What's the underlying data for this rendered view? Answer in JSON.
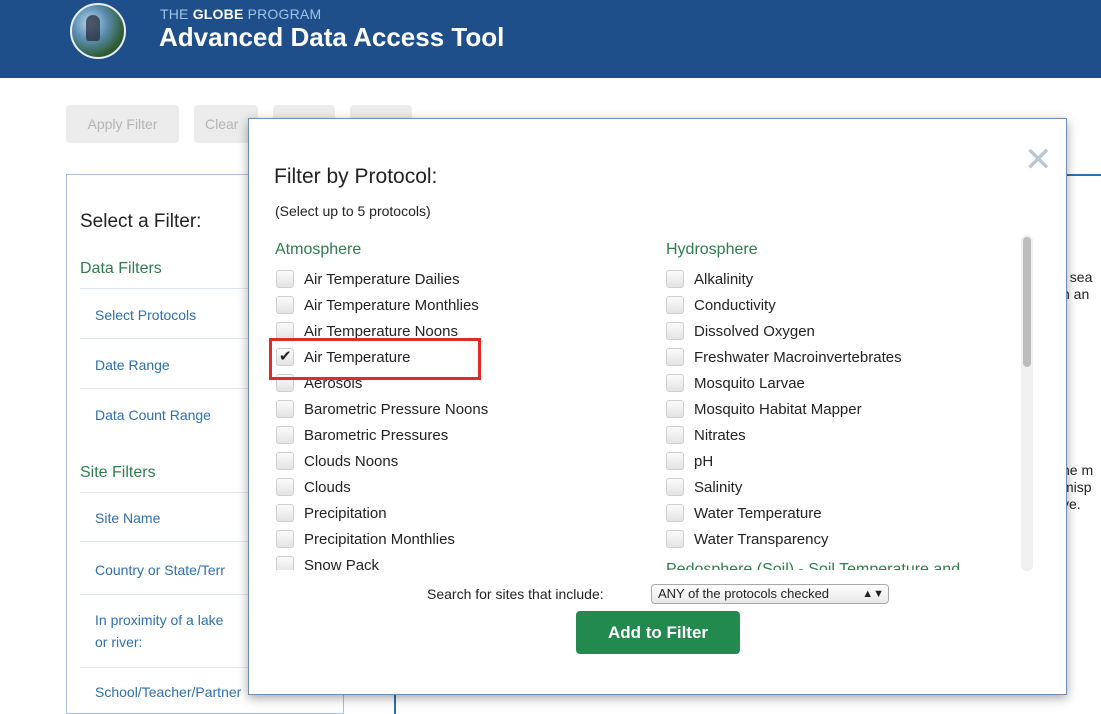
{
  "header": {
    "program_prefix": "THE",
    "program_bold": "GLOBE",
    "program_suffix": "PROGRAM",
    "tool_title": "Advanced Data Access Tool"
  },
  "toolbar": {
    "apply_filter": "Apply Filter",
    "clear": "Clear"
  },
  "sidebar": {
    "title": "Select a Filter:",
    "data_filters_heading": "Data Filters",
    "data_filters": [
      "Select Protocols",
      "Date Range",
      "Data Count Range"
    ],
    "site_filters_heading": "Site Filters",
    "site_filters": [
      "Site Name",
      "Country or State/Terr",
      "In proximity of a lake",
      "or river:",
      "School/Teacher/Partner"
    ]
  },
  "background_text": {
    "line1": "t sea",
    "line2": "n an",
    "line3": "he m",
    "line4": "misp",
    "line5": "ve."
  },
  "modal": {
    "close_glyph": "✕",
    "title": "Filter by Protocol:",
    "subtitle": "(Select up to 5 protocols)",
    "atmosphere_heading": "Atmosphere",
    "atmosphere": [
      {
        "label": "Air Temperature Dailies",
        "checked": false
      },
      {
        "label": "Air Temperature Monthlies",
        "checked": false
      },
      {
        "label": "Air Temperature Noons",
        "checked": false
      },
      {
        "label": "Air Temperature",
        "checked": true
      },
      {
        "label": "Aerosols",
        "checked": false
      },
      {
        "label": "Barometric Pressure Noons",
        "checked": false
      },
      {
        "label": "Barometric Pressures",
        "checked": false
      },
      {
        "label": "Clouds Noons",
        "checked": false
      },
      {
        "label": "Clouds",
        "checked": false
      },
      {
        "label": "Precipitation",
        "checked": false
      },
      {
        "label": "Precipitation Monthlies",
        "checked": false
      },
      {
        "label": "Snow Pack",
        "checked": false
      }
    ],
    "hydrosphere_heading": "Hydrosphere",
    "hydrosphere": [
      {
        "label": "Alkalinity",
        "checked": false
      },
      {
        "label": "Conductivity",
        "checked": false
      },
      {
        "label": "Dissolved Oxygen",
        "checked": false
      },
      {
        "label": "Freshwater Macroinvertebrates",
        "checked": false
      },
      {
        "label": "Mosquito Larvae",
        "checked": false
      },
      {
        "label": "Mosquito Habitat Mapper",
        "checked": false
      },
      {
        "label": "Nitrates",
        "checked": false
      },
      {
        "label": "pH",
        "checked": false
      },
      {
        "label": "Salinity",
        "checked": false
      },
      {
        "label": "Water Temperature",
        "checked": false
      },
      {
        "label": "Water Transparency",
        "checked": false
      }
    ],
    "next_heading_partial": "Pedosphere (Soil) - Soil Temperature and",
    "search_label": "Search for sites that include:",
    "search_select": "ANY of the protocols checked",
    "add_button": "Add to Filter"
  },
  "colors": {
    "header_bg": "#1f4f8b",
    "section_green": "#2e7d4f",
    "link_blue": "#2f6fae",
    "button_green": "#228a4e",
    "highlight_red": "#e02b2b"
  }
}
